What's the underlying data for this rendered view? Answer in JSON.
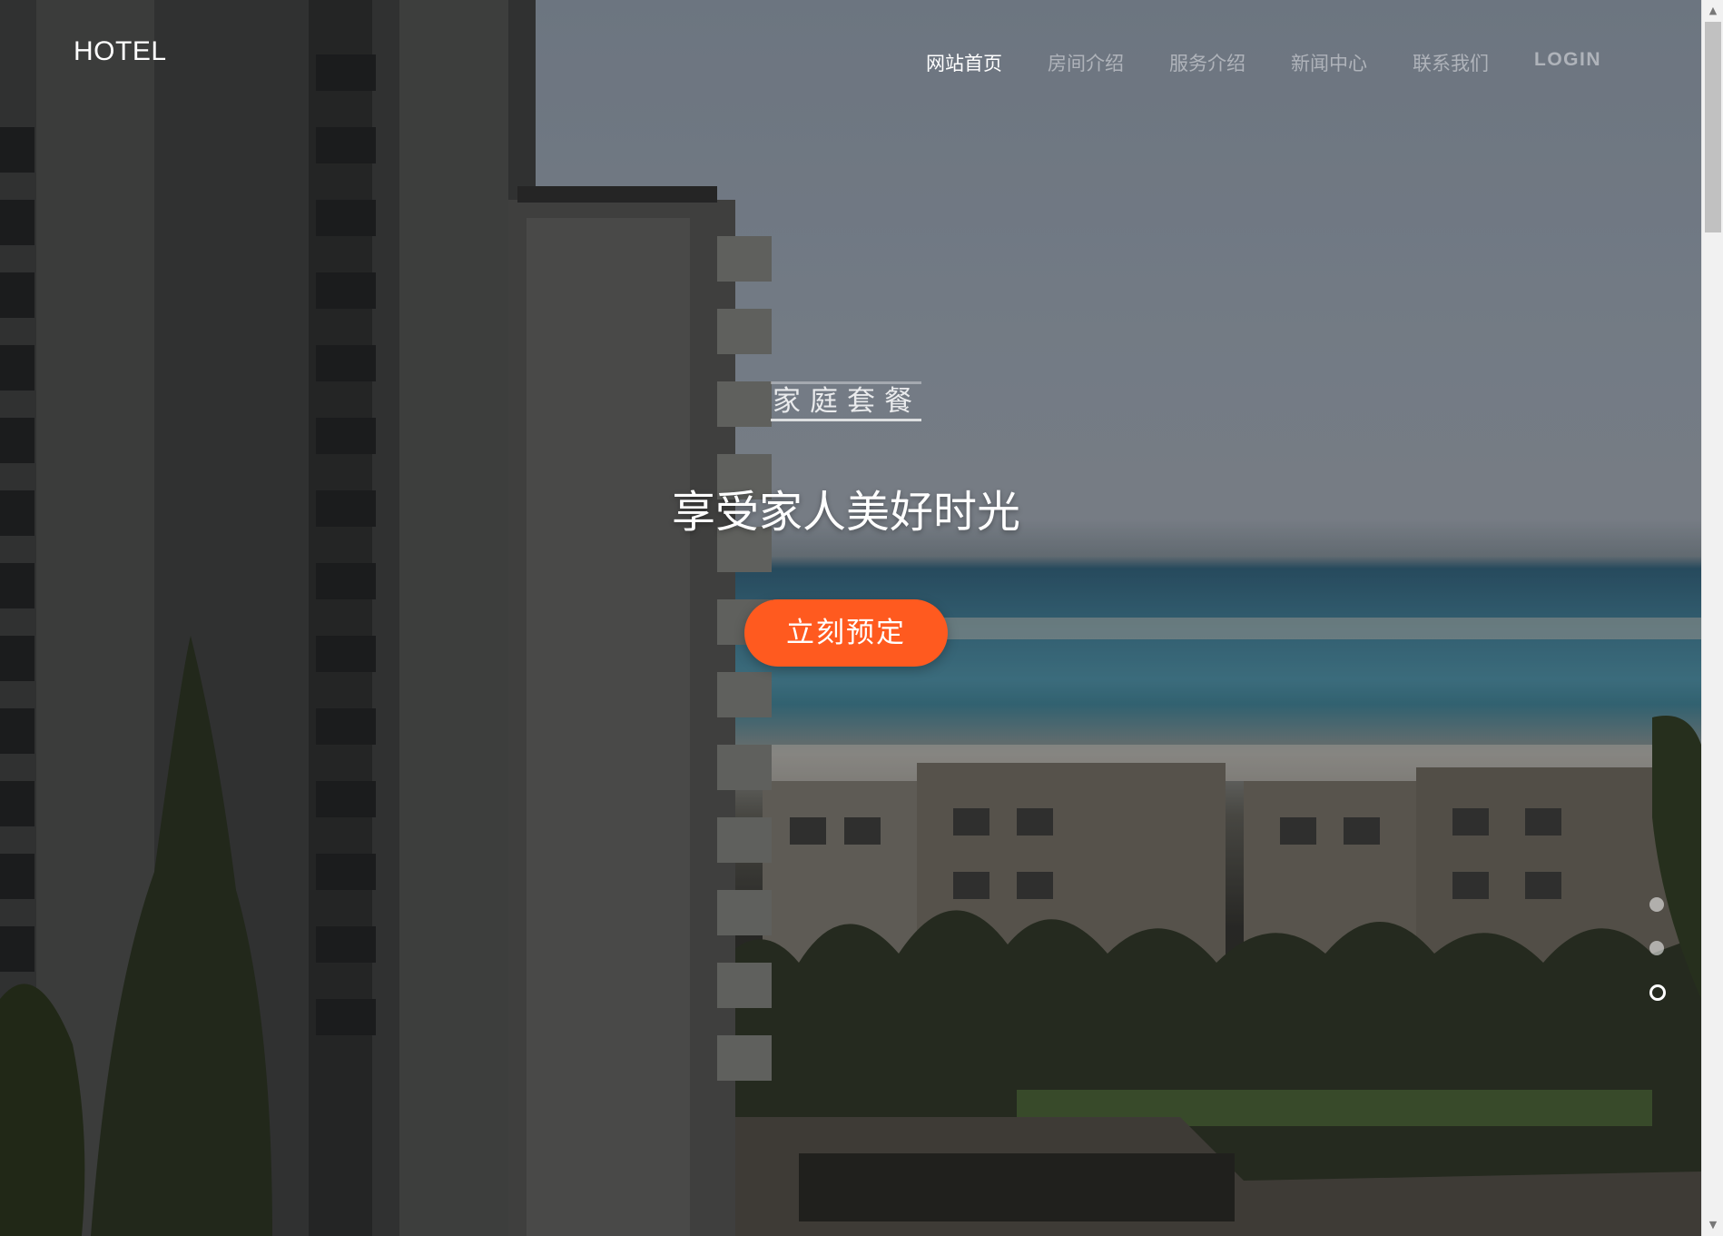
{
  "header": {
    "logo": "HOTEL",
    "nav": [
      {
        "label": "网站首页",
        "active": true
      },
      {
        "label": "房间介绍",
        "active": false
      },
      {
        "label": "服务介绍",
        "active": false
      },
      {
        "label": "新闻中心",
        "active": false
      },
      {
        "label": "联系我们",
        "active": false
      },
      {
        "label": "LOGIN",
        "active": false
      }
    ]
  },
  "hero": {
    "tag": "家庭套餐",
    "title": "享受家人美好时光",
    "button_label": "立刻预定"
  },
  "slider": {
    "slide_count": 3,
    "active_index": 2
  },
  "colors": {
    "accent": "#ff5a1f",
    "nav_active": "#ffffff",
    "nav_inactive": "rgba(255,255,255,0.45)"
  },
  "scrollbar": {
    "up_icon": "scroll-up-arrow-icon",
    "down_icon": "scroll-down-arrow-icon"
  }
}
